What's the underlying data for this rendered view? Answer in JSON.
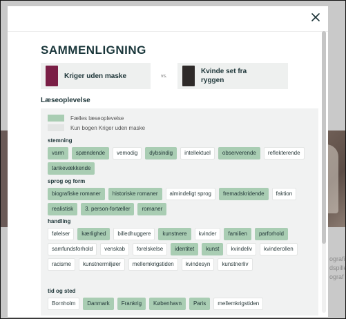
{
  "modal": {
    "title": "SAMMENLIGNING",
    "vs": "vs.",
    "close_icon": "close-icon",
    "book_a": {
      "title": "Kriger uden maske",
      "cover_color": "#7a1f46"
    },
    "book_b": {
      "title": "Kvinde set fra ryggen",
      "cover_color": "#2e2a29"
    },
    "section": "Læseoplevelse",
    "legend": {
      "shared": {
        "label": "Fælles læseoplevelse",
        "color": "#a9cdb3"
      },
      "only": {
        "label": "Kun bogen Kriger uden maske",
        "color": "#e3e5e4"
      }
    },
    "groups": [
      {
        "title": "stemning",
        "tags": [
          {
            "label": "varm",
            "shared": true
          },
          {
            "label": "spændende",
            "shared": true
          },
          {
            "label": "vemodig",
            "shared": false
          },
          {
            "label": "dybsindig",
            "shared": true
          },
          {
            "label": "intellektuel",
            "shared": false
          },
          {
            "label": "observerende",
            "shared": true
          },
          {
            "label": "reflekterende",
            "shared": false
          },
          {
            "label": "tankevækkende",
            "shared": true
          }
        ]
      },
      {
        "title": "sprog og form",
        "tags": [
          {
            "label": "biografiske romaner",
            "shared": true
          },
          {
            "label": "historiske romaner",
            "shared": true
          },
          {
            "label": "almindeligt sprog",
            "shared": false
          },
          {
            "label": "fremadskridende",
            "shared": true
          },
          {
            "label": "faktion",
            "shared": false
          },
          {
            "label": "realistisk",
            "shared": true
          },
          {
            "label": "3. person-fortæller",
            "shared": true
          },
          {
            "label": "romaner",
            "shared": true
          }
        ]
      },
      {
        "title": "handling",
        "tags": [
          {
            "label": "følelser",
            "shared": false
          },
          {
            "label": "kærlighed",
            "shared": true
          },
          {
            "label": "billedhuggere",
            "shared": false
          },
          {
            "label": "kunstnere",
            "shared": true
          },
          {
            "label": "kvinder",
            "shared": false
          },
          {
            "label": "familien",
            "shared": true
          },
          {
            "label": "parforhold",
            "shared": true
          },
          {
            "label": "samfundsforhold",
            "shared": false
          },
          {
            "label": "venskab",
            "shared": false
          },
          {
            "label": "forelskelse",
            "shared": false
          },
          {
            "label": "identitet",
            "shared": true
          },
          {
            "label": "kunst",
            "shared": true
          },
          {
            "label": "kvindeliv",
            "shared": false
          },
          {
            "label": "kvinderollen",
            "shared": false
          },
          {
            "label": "racisme",
            "shared": false
          },
          {
            "label": "kunstnermiljøer",
            "shared": false
          },
          {
            "label": "mellemkrigstiden",
            "shared": false
          },
          {
            "label": "kvindesyn",
            "shared": false
          },
          {
            "label": "kunstnerliv",
            "shared": false
          }
        ]
      },
      {
        "title": "tid og sted",
        "tags": [
          {
            "label": "Bornholm",
            "shared": false
          },
          {
            "label": "Danmark",
            "shared": true
          },
          {
            "label": "Frankrig",
            "shared": true
          },
          {
            "label": "København",
            "shared": true
          },
          {
            "label": "Paris",
            "shared": true
          },
          {
            "label": "mellemkrigstiden",
            "shared": false
          }
        ]
      }
    ]
  },
  "background": {
    "right_text": [
      "ografis",
      "dspille",
      "ograf"
    ]
  }
}
